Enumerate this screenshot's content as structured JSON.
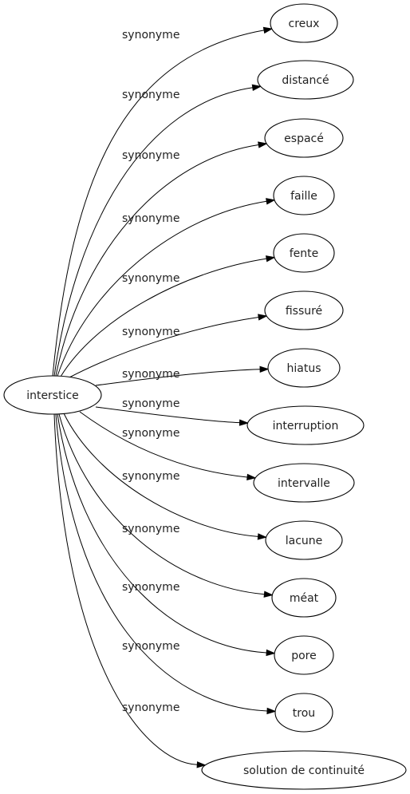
{
  "graph": {
    "source": {
      "id": "interstice",
      "label": "interstice"
    },
    "relation_label": "synonyme",
    "targets": [
      {
        "id": "creux",
        "label": "creux"
      },
      {
        "id": "distance",
        "label": "distancé"
      },
      {
        "id": "espace",
        "label": "espacé"
      },
      {
        "id": "faille",
        "label": "faille"
      },
      {
        "id": "fente",
        "label": "fente"
      },
      {
        "id": "fissure",
        "label": "fissuré"
      },
      {
        "id": "hiatus",
        "label": "hiatus"
      },
      {
        "id": "interruption",
        "label": "interruption"
      },
      {
        "id": "intervalle",
        "label": "intervalle"
      },
      {
        "id": "lacune",
        "label": "lacune"
      },
      {
        "id": "meat",
        "label": "méat"
      },
      {
        "id": "pore",
        "label": "pore"
      },
      {
        "id": "trou",
        "label": "trou"
      },
      {
        "id": "solution-de-continuite",
        "label": "solution de continuité"
      }
    ],
    "edges": [
      {
        "from": "interstice",
        "to": "creux",
        "label": "synonyme"
      },
      {
        "from": "interstice",
        "to": "distance",
        "label": "synonyme"
      },
      {
        "from": "interstice",
        "to": "espace",
        "label": "synonyme"
      },
      {
        "from": "interstice",
        "to": "faille",
        "label": "synonyme"
      },
      {
        "from": "interstice",
        "to": "fente",
        "label": "synonyme"
      },
      {
        "from": "interstice",
        "to": "fissure",
        "label": "synonyme"
      },
      {
        "from": "interstice",
        "to": "hiatus",
        "label": "synonyme"
      },
      {
        "from": "interstice",
        "to": "interruption",
        "label": "synonyme"
      },
      {
        "from": "interstice",
        "to": "intervalle",
        "label": "synonyme"
      },
      {
        "from": "interstice",
        "to": "lacune",
        "label": "synonyme"
      },
      {
        "from": "interstice",
        "to": "meat",
        "label": "synonyme"
      },
      {
        "from": "interstice",
        "to": "pore",
        "label": "synonyme"
      },
      {
        "from": "interstice",
        "to": "trou",
        "label": "synonyme"
      },
      {
        "from": "interstice",
        "to": "solution-de-continuite",
        "label": "synonyme"
      }
    ]
  }
}
